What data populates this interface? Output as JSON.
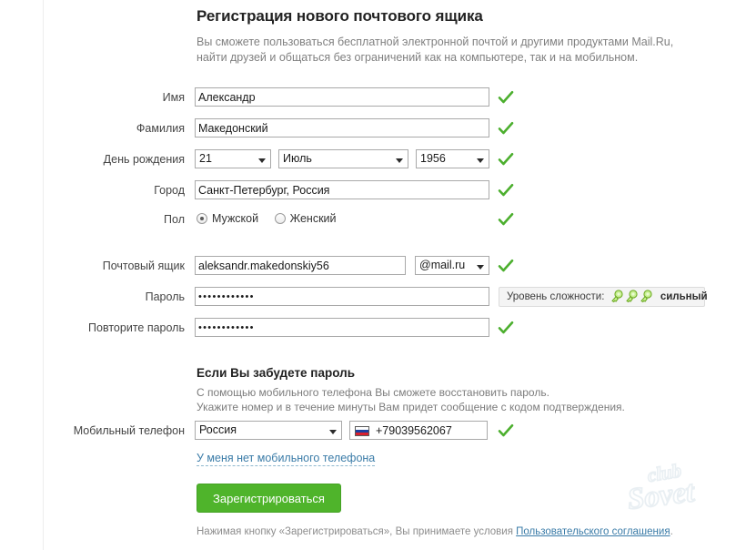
{
  "header": {
    "title": "Регистрация нового почтового ящика",
    "subtitle": "Вы сможете пользоваться бесплатной электронной почтой и другими продуктами Mail.Ru, найти друзей и общаться без ограничений как на компьютере, так и на мобильном."
  },
  "form": {
    "first_name": {
      "label": "Имя",
      "value": "Александр",
      "valid": true
    },
    "last_name": {
      "label": "Фамилия",
      "value": "Македонский",
      "valid": true
    },
    "birthday": {
      "label": "День рождения",
      "day": "21",
      "month": "Июль",
      "year": "1956",
      "valid": true
    },
    "city": {
      "label": "Город",
      "value": "Санкт-Петербург, Россия",
      "valid": true
    },
    "gender": {
      "label": "Пол",
      "male_label": "Мужской",
      "female_label": "Женский",
      "selected": "male",
      "valid": true
    },
    "mailbox": {
      "label": "Почтовый ящик",
      "value": "aleksandr.makedonskiy56",
      "domain": "@mail.ru",
      "valid": true
    },
    "password": {
      "label": "Пароль",
      "value": "••••••••••••",
      "strength_label": "Уровень сложности:",
      "strength_value": "сильный",
      "strength_keys": 3
    },
    "password_repeat": {
      "label": "Повторите пароль",
      "value": "••••••••••••",
      "valid": true
    },
    "phone": {
      "label": "Мобильный телефон",
      "country": "Россия",
      "number": "+79039562067",
      "flag": "ru-flag-icon",
      "valid": true
    },
    "no_phone_link": "У меня нет мобильного телефона"
  },
  "forgot": {
    "title": "Если Вы забудете пароль",
    "line1": "С помощью мобильного телефона Вы сможете восстановить пароль.",
    "line2": "Укажите номер и в течение минуты Вам придет сообщение с кодом подтверждения."
  },
  "submit": {
    "label": "Зарегистрироваться"
  },
  "footer": {
    "prefix": "Нажимая кнопку «Зарегистрироваться», Вы принимаете условия ",
    "link": "Пользовательского соглашения",
    "suffix": "."
  },
  "watermark": {
    "line1": "club",
    "line2": "Sovet"
  },
  "colors": {
    "accent_green": "#4fb42b",
    "check_green": "#4caf2e",
    "key_green": "#b8e986",
    "link_blue": "#3b7ca8",
    "label_gray": "#444444",
    "muted_gray": "#808080"
  }
}
